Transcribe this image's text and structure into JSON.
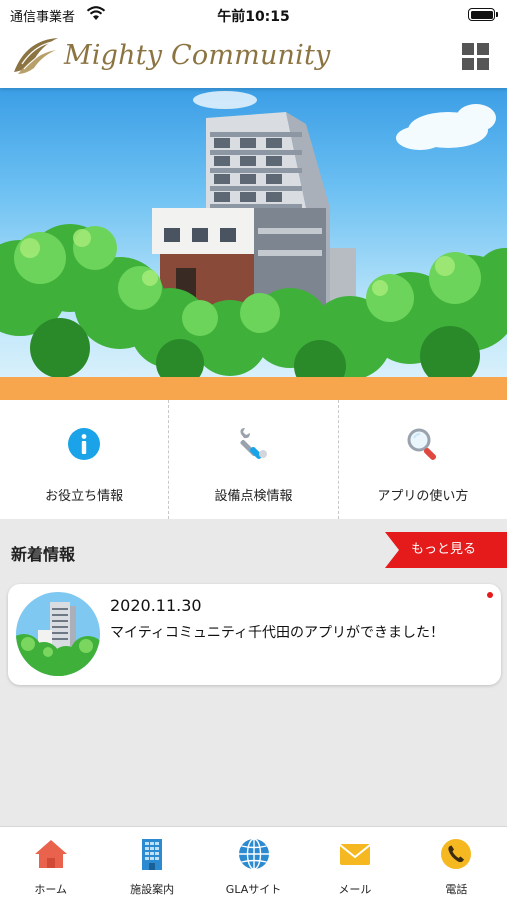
{
  "status_bar": {
    "carrier": "通信事業者",
    "time": "午前10:15"
  },
  "header": {
    "logo_text": "Mighty Community",
    "menu_icon": "grid-menu-icon"
  },
  "quick_menu": {
    "items": [
      {
        "label": "お役立ち情報",
        "icon": "info-icon"
      },
      {
        "label": "設備点検情報",
        "icon": "wrench-icon"
      },
      {
        "label": "アプリの使い方",
        "icon": "magnifier-icon"
      }
    ]
  },
  "news": {
    "section_title": "新着情報",
    "more_label": "もっと見る",
    "items": [
      {
        "date": "2020.11.30",
        "headline": "マイティコミュニティ千代田のアプリができました！"
      }
    ]
  },
  "tabbar": {
    "tabs": [
      {
        "label": "ホーム",
        "icon": "home-icon"
      },
      {
        "label": "施設案内",
        "icon": "building-icon"
      },
      {
        "label": "GLAサイト",
        "icon": "globe-icon"
      },
      {
        "label": "メール",
        "icon": "mail-icon"
      },
      {
        "label": "電話",
        "icon": "phone-icon"
      }
    ]
  },
  "colors": {
    "accent_red": "#e51a1a",
    "band_orange": "#f7a64e",
    "logo_gold": "#8b7442",
    "info_blue": "#1aa3e8"
  }
}
